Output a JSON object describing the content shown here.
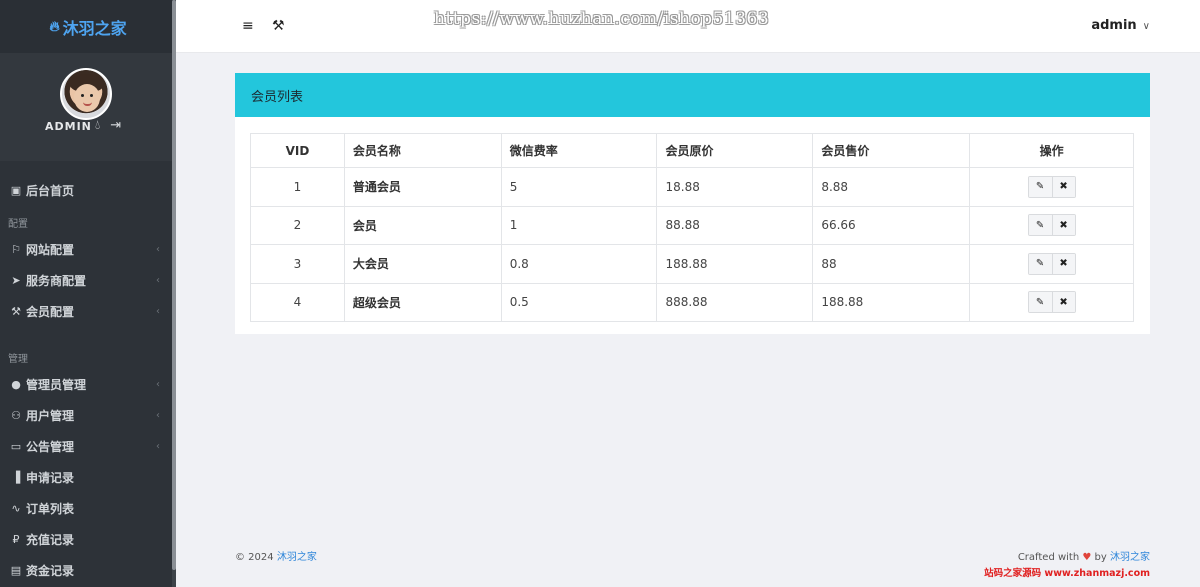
{
  "brand": {
    "title": "沐羽之家",
    "color": "#4ea4f0"
  },
  "user": {
    "name": "ADMIN"
  },
  "sidebar": {
    "items_top": [
      {
        "label": "后台首页",
        "icon": "dashboard-icon"
      }
    ],
    "section_config": "配置",
    "items_config": [
      {
        "label": "网站配置",
        "icon": "tag-icon"
      },
      {
        "label": "服务商配置",
        "icon": "send-icon"
      },
      {
        "label": "会员配置",
        "icon": "wrench-icon"
      }
    ],
    "section_manage": "管理",
    "items_manage": [
      {
        "label": "管理员管理",
        "icon": "user-icon"
      },
      {
        "label": "用户管理",
        "icon": "users-icon"
      },
      {
        "label": "公告管理",
        "icon": "comment-icon"
      },
      {
        "label": "申请记录",
        "icon": "bar-chart-icon"
      },
      {
        "label": "订单列表",
        "icon": "line-chart-icon"
      },
      {
        "label": "充值记录",
        "icon": "ruble-icon"
      },
      {
        "label": "资金记录",
        "icon": "money-icon"
      }
    ]
  },
  "topbar": {
    "watermark": "https://www.huzhan.com/ishop51363",
    "admin_label": "admin"
  },
  "panel": {
    "title": "会员列表",
    "header_color": "#23c6dc"
  },
  "table": {
    "headers": [
      "VID",
      "会员名称",
      "微信费率",
      "会员原价",
      "会员售价",
      "操作"
    ],
    "rows": [
      {
        "vid": "1",
        "name": "普通会员",
        "rate": "5",
        "original": "18.88",
        "sale": "8.88"
      },
      {
        "vid": "2",
        "name": "会员",
        "rate": "1",
        "original": "88.88",
        "sale": "66.66"
      },
      {
        "vid": "3",
        "name": "大会员",
        "rate": "0.8",
        "original": "188.88",
        "sale": "88"
      },
      {
        "vid": "4",
        "name": "超级会员",
        "rate": "0.5",
        "original": "888.88",
        "sale": "188.88"
      }
    ]
  },
  "footer": {
    "copyright": "© 2024",
    "site": "沐羽之家",
    "crafted": "Crafted with",
    "by": "by",
    "author": "沐羽之家",
    "stamp": "站码之家源码 www.zhanmazj.com"
  }
}
